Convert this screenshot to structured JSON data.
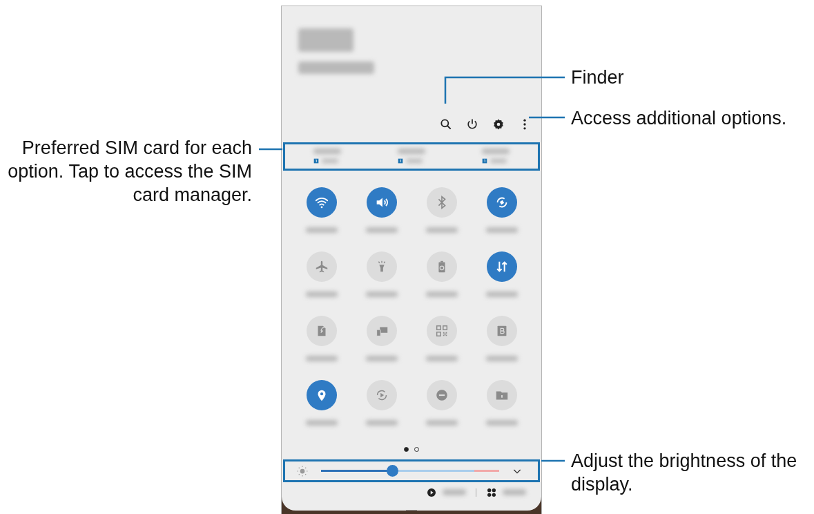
{
  "phone": {
    "header_icons": [
      {
        "kind": "search"
      },
      {
        "kind": "power"
      },
      {
        "kind": "settings"
      },
      {
        "kind": "more"
      }
    ],
    "sim_preferences": [
      {
        "kind": "sim"
      },
      {
        "kind": "sim"
      },
      {
        "kind": "sim"
      }
    ],
    "tiles": [
      {
        "kind": "wifi",
        "on": true
      },
      {
        "kind": "sound",
        "on": true
      },
      {
        "kind": "bluetooth",
        "on": false
      },
      {
        "kind": "rotate",
        "on": true
      },
      {
        "kind": "airplane",
        "on": false
      },
      {
        "kind": "torch",
        "on": false
      },
      {
        "kind": "battery",
        "on": false
      },
      {
        "kind": "data",
        "on": true
      },
      {
        "kind": "hotspot",
        "on": false
      },
      {
        "kind": "devices",
        "on": false
      },
      {
        "kind": "qr",
        "on": false
      },
      {
        "kind": "bluelight",
        "on": false
      },
      {
        "kind": "location",
        "on": true
      },
      {
        "kind": "play",
        "on": false
      },
      {
        "kind": "dnd",
        "on": false
      },
      {
        "kind": "folder",
        "on": false
      }
    ],
    "page_dots": [
      {
        "selected": true
      },
      {
        "selected": false
      }
    ],
    "brightness": {
      "level": 0.4
    },
    "bottom_buttons": [
      {
        "kind": "media"
      },
      {
        "kind": "devices"
      }
    ]
  },
  "callouts": [
    {
      "text": "Finder"
    },
    {
      "text": "Access additional options."
    },
    {
      "text": "Preferred SIM card for each option. Tap to access the SIM card manager."
    },
    {
      "text": "Adjust the brightness of the display."
    }
  ]
}
